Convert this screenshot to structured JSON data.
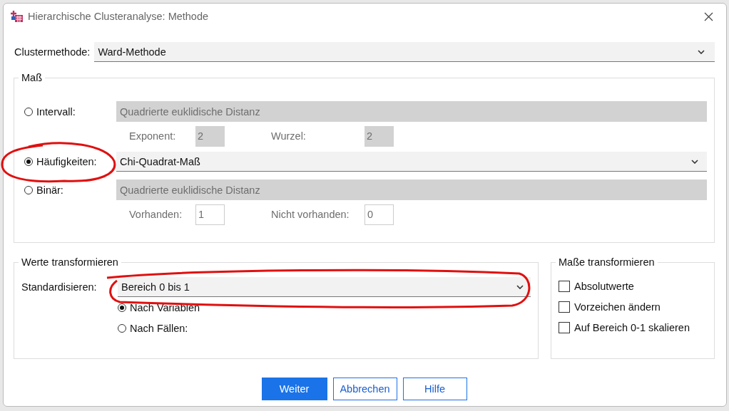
{
  "window": {
    "title": "Hierarchische Clusteranalyse: Methode"
  },
  "cluster_method": {
    "label": "Clustermethode:",
    "value": "Ward-Methode"
  },
  "measure": {
    "title": "Maß",
    "options": [
      {
        "kind": "interval",
        "label": "Intervall:",
        "selected": false,
        "disabled": true,
        "value": "Quadrierte euklidische Distanz",
        "params": [
          {
            "label": "Exponent:",
            "value": "2"
          },
          {
            "label": "Wurzel:",
            "value": "2"
          }
        ]
      },
      {
        "kind": "frequency",
        "label": "Häufigkeiten:",
        "selected": true,
        "disabled": false,
        "value": "Chi-Quadrat-Maß"
      },
      {
        "kind": "binary",
        "label": "Binär:",
        "selected": false,
        "disabled": true,
        "value": "Quadrierte euklidische Distanz",
        "params": [
          {
            "label": "Vorhanden:",
            "value": "1"
          },
          {
            "label": "Nicht vorhanden:",
            "value": "0"
          }
        ]
      }
    ]
  },
  "transform_values": {
    "title": "Werte transformieren",
    "standardize": {
      "label": "Standardisieren:",
      "value": "Bereich 0 bis 1"
    },
    "scope": [
      {
        "label": "Nach Variablen",
        "selected": true
      },
      {
        "label": "Nach Fällen:",
        "selected": false
      }
    ]
  },
  "transform_measures": {
    "title": "Maße transformieren",
    "options": [
      {
        "label": "Absolutwerte",
        "checked": false
      },
      {
        "label": "Vorzeichen ändern",
        "checked": false
      },
      {
        "label": "Auf Bereich 0-1 skalieren",
        "checked": false
      }
    ]
  },
  "buttons": [
    {
      "label": "Weiter",
      "primary": true
    },
    {
      "label": "Abbrechen",
      "primary": false
    },
    {
      "label": "Hilfe",
      "primary": false
    }
  ]
}
